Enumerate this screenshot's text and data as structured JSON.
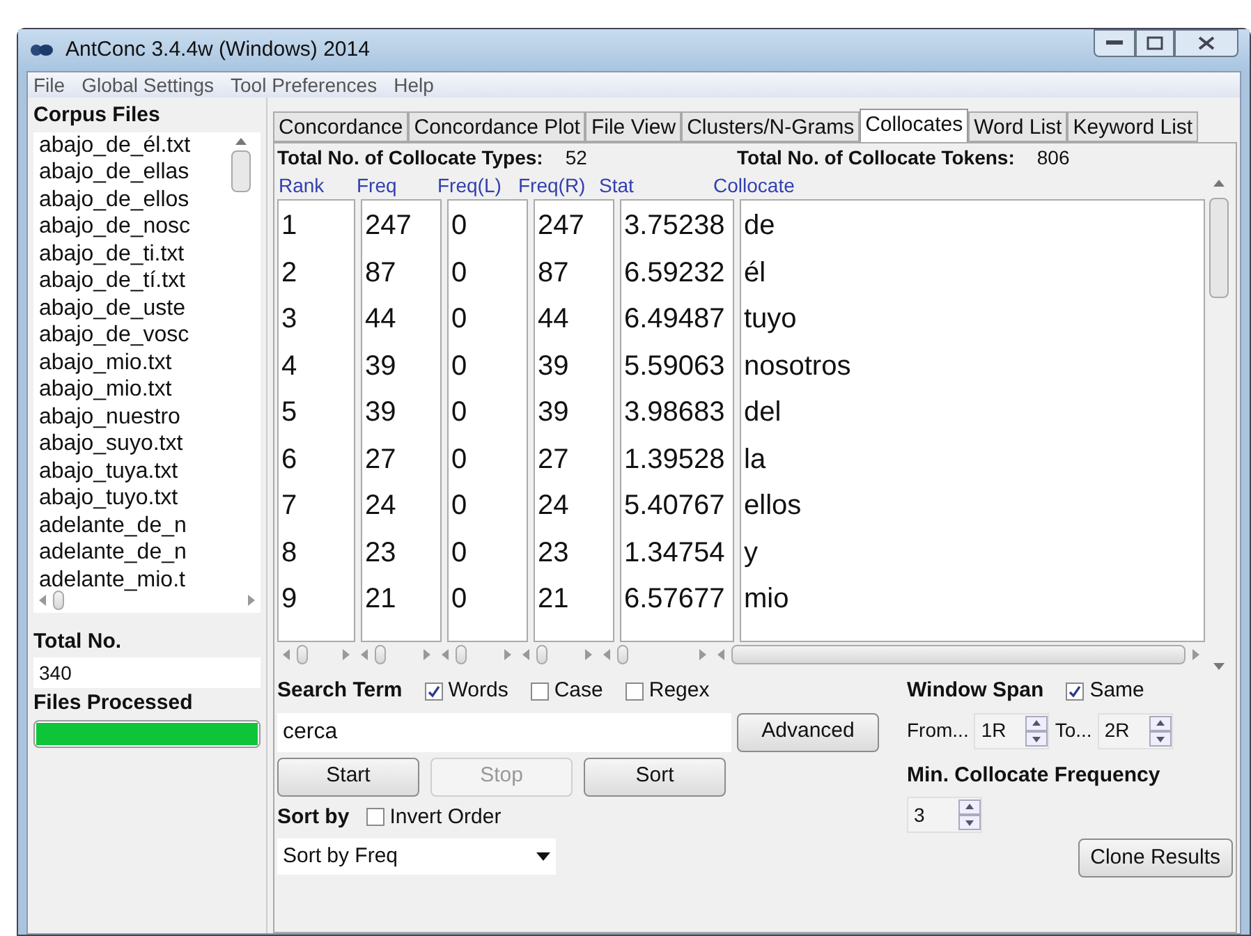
{
  "window": {
    "title": "AntConc 3.4.4w (Windows) 2014"
  },
  "menu": [
    "File",
    "Global Settings",
    "Tool Preferences",
    "Help"
  ],
  "corpus_files": {
    "title": "Corpus Files",
    "files": [
      "abajo_de_él.txt",
      "abajo_de_ellas",
      "abajo_de_ellos",
      "abajo_de_nosc",
      "abajo_de_ti.txt",
      "abajo_de_tí.txt",
      "abajo_de_uste",
      "abajo_de_vosc",
      "abajo_mio.txt",
      "abajo_mio.txt",
      "abajo_nuestro",
      "abajo_suyo.txt",
      "abajo_tuya.txt",
      "abajo_tuyo.txt",
      "adelante_de_n",
      "adelante_de_n",
      "adelante_mio.t"
    ],
    "total_label": "Total No.",
    "total_value": "340",
    "processed_label": "Files Processed",
    "level": 1
  },
  "tabs": [
    {
      "label": "Concordance",
      "selected": false
    },
    {
      "label": "Concordance Plot",
      "selected": false
    },
    {
      "label": "File View",
      "selected": false
    },
    {
      "label": "Clusters/N-Grams",
      "selected": false
    },
    {
      "label": "Collocates",
      "selected": true
    },
    {
      "label": "Word List",
      "selected": false
    },
    {
      "label": "Keyword List",
      "selected": false
    }
  ],
  "summary": [
    {
      "label": "Total No. of Collocate Types:",
      "value": "52"
    },
    {
      "label": "Total No. of Collocate Tokens:",
      "value": "806"
    }
  ],
  "table": {
    "columns": [
      "Rank",
      "Freq",
      "Freq(L)",
      "Freq(R)",
      "Stat",
      "Collocate"
    ],
    "rows": [
      [
        "1",
        "247",
        "0",
        "247",
        "3.75238",
        "de"
      ],
      [
        "2",
        "87",
        "0",
        "87",
        "6.59232",
        "él"
      ],
      [
        "3",
        "44",
        "0",
        "44",
        "6.49487",
        "tuyo"
      ],
      [
        "4",
        "39",
        "0",
        "39",
        "5.59063",
        "nosotros"
      ],
      [
        "5",
        "39",
        "0",
        "39",
        "3.98683",
        "del"
      ],
      [
        "6",
        "27",
        "0",
        "27",
        "1.39528",
        "la"
      ],
      [
        "7",
        "24",
        "0",
        "24",
        "5.40767",
        "ellos"
      ],
      [
        "8",
        "23",
        "0",
        "23",
        "1.34754",
        "y"
      ],
      [
        "9",
        "21",
        "0",
        "21",
        "6.57677",
        "mio"
      ]
    ]
  },
  "search": {
    "label": "Search Term",
    "options": [
      {
        "label": "Words",
        "checked": true
      },
      {
        "label": "Case",
        "checked": false
      },
      {
        "label": "Regex",
        "checked": false
      }
    ],
    "value": "cerca",
    "advanced": "Advanced"
  },
  "buttons": [
    {
      "label": "Start",
      "disabled": false
    },
    {
      "label": "Stop",
      "disabled": true
    },
    {
      "label": "Sort",
      "disabled": false
    }
  ],
  "sort": {
    "label": "Sort by",
    "invert": {
      "label": "Invert Order",
      "checked": false
    },
    "value": "Sort by Freq"
  },
  "window_span": {
    "label": "Window Span",
    "same": {
      "label": "Same",
      "checked": true
    },
    "from_label": "From...",
    "from_value": "1R",
    "to_label": "To...",
    "to_value": "2R"
  },
  "min_freq": {
    "label": "Min. Collocate Frequency",
    "value": "3"
  },
  "clone": "Clone Results"
}
